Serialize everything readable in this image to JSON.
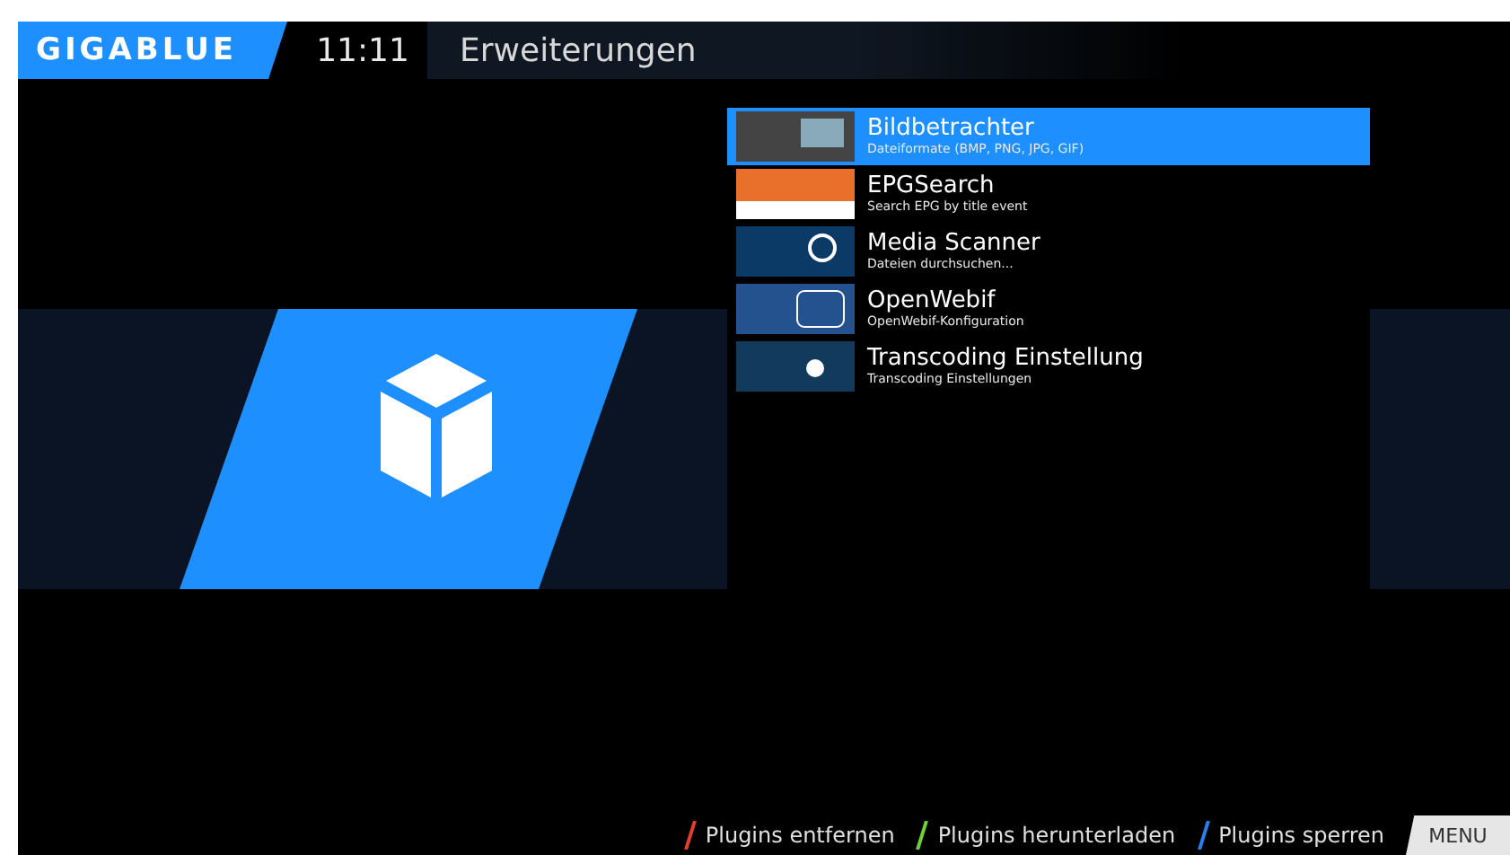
{
  "header": {
    "logo": "GIGABLUE",
    "time": "11:11",
    "title": "Erweiterungen"
  },
  "plugins": [
    {
      "name": "Bildbetrachter",
      "description": "Dateiformate (BMP, PNG, JPG, GIF)",
      "selected": true,
      "kind": "photo"
    },
    {
      "name": "EPGSearch",
      "description": "Search EPG by title event",
      "selected": false,
      "kind": "epg"
    },
    {
      "name": "Media Scanner",
      "description": "Dateien durchsuchen...",
      "selected": false,
      "kind": "scanner"
    },
    {
      "name": "OpenWebif",
      "description": "OpenWebif-Konfiguration",
      "selected": false,
      "kind": "webif"
    },
    {
      "name": "Transcoding Einstellung",
      "description": "Transcoding Einstellungen",
      "selected": false,
      "kind": "transcode"
    }
  ],
  "buttons": [
    {
      "label": "Plugins entfernen",
      "color": "#e0402a"
    },
    {
      "label": "Plugins herunterladen",
      "color": "#6fd13a"
    },
    {
      "label": "Plugins sperren",
      "color": "#2a7fe8"
    }
  ],
  "menu_key": "MENU"
}
